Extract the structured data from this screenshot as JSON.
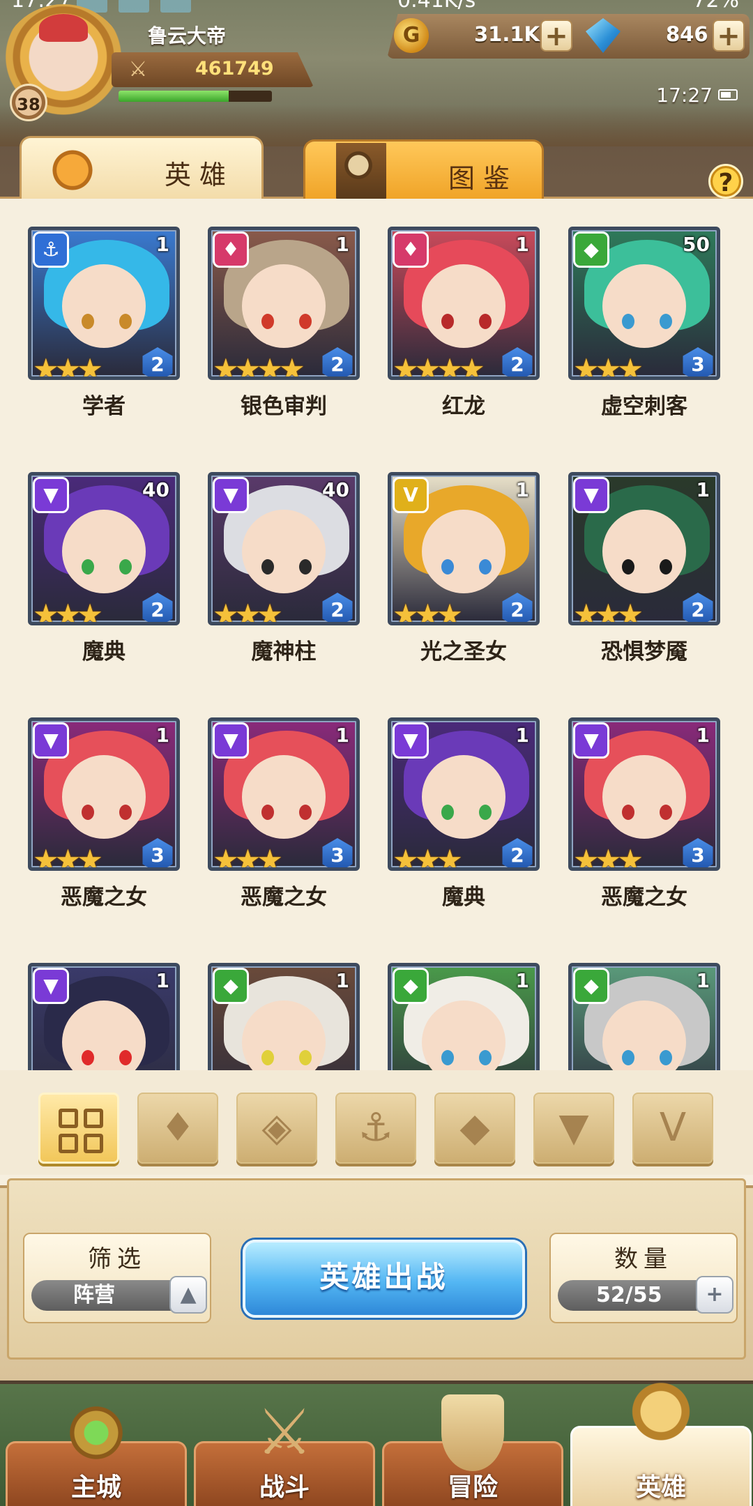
{
  "status_bar": {
    "time": "17:27",
    "network_speed": "0.41K/s",
    "signal": "4G",
    "battery": "72%"
  },
  "player": {
    "name": "鲁云大帝",
    "level": "38",
    "power": "461749",
    "exp_fraction": 0.72
  },
  "resources": {
    "gold": "31.1K",
    "gems": "846",
    "plus": "+"
  },
  "game_clock": "17:27",
  "tabs": {
    "heroes": "英雄",
    "codex": "图鉴"
  },
  "help": "?",
  "heroes": [
    {
      "name": "学者",
      "level": "1",
      "grade": "2",
      "stars": 3,
      "faction": "anchor",
      "faction_icon": "⚓",
      "faction_color": "#2f6fd6",
      "hair": "#35b8e8",
      "bg": "#3a7ad0",
      "eye": "#c98a2a"
    },
    {
      "name": "银色审判",
      "level": "1",
      "grade": "2",
      "stars": 4,
      "faction": "flame",
      "faction_icon": "♦",
      "faction_color": "#d63a6a",
      "hair": "#b9a58a",
      "bg": "#8a5a4a",
      "eye": "#d03a2a"
    },
    {
      "name": "红龙",
      "level": "1",
      "grade": "2",
      "stars": 4,
      "faction": "flame",
      "faction_icon": "♦",
      "faction_color": "#d63a6a",
      "hair": "#e64a5a",
      "bg": "#c94a5a",
      "eye": "#b82a2a"
    },
    {
      "name": "虚空刺客",
      "level": "50",
      "grade": "3",
      "stars": 3,
      "faction": "beast",
      "faction_icon": "◆",
      "faction_color": "#3aa83a",
      "hair": "#3cbf9a",
      "bg": "#2e7a5a",
      "eye": "#3a9ad0"
    },
    {
      "name": "魔典",
      "level": "40",
      "grade": "2",
      "stars": 3,
      "faction": "demon",
      "faction_icon": "▼",
      "faction_color": "#7a3ad6",
      "hair": "#6a3ab8",
      "bg": "#4a2a7a",
      "eye": "#3aa84a"
    },
    {
      "name": "魔神柱",
      "level": "40",
      "grade": "2",
      "stars": 3,
      "faction": "demon",
      "faction_icon": "▼",
      "faction_color": "#7a3ad6",
      "hair": "#dcdde2",
      "bg": "#5a3a6a",
      "eye": "#2a2a2a"
    },
    {
      "name": "光之圣女",
      "level": "1",
      "grade": "2",
      "stars": 3,
      "faction": "light",
      "faction_icon": "V",
      "faction_color": "#e0b01a",
      "hair": "#e8a82a",
      "bg": "#e8e0c8",
      "eye": "#3a8ad6"
    },
    {
      "name": "恐惧梦魇",
      "level": "1",
      "grade": "2",
      "stars": 3,
      "faction": "demon",
      "faction_icon": "▼",
      "faction_color": "#7a3ad6",
      "hair": "#2a6a4a",
      "bg": "#2a3a2a",
      "eye": "#1a1a1a"
    },
    {
      "name": "恶魔之女",
      "level": "1",
      "grade": "3",
      "stars": 3,
      "faction": "demon",
      "faction_icon": "▼",
      "faction_color": "#7a3ad6",
      "hair": "#e6505a",
      "bg": "#8a2a7a",
      "eye": "#c03030"
    },
    {
      "name": "恶魔之女",
      "level": "1",
      "grade": "3",
      "stars": 3,
      "faction": "demon",
      "faction_icon": "▼",
      "faction_color": "#7a3ad6",
      "hair": "#e6505a",
      "bg": "#8a2a7a",
      "eye": "#c03030"
    },
    {
      "name": "魔典",
      "level": "1",
      "grade": "2",
      "stars": 3,
      "faction": "demon",
      "faction_icon": "▼",
      "faction_color": "#7a3ad6",
      "hair": "#6a3ab8",
      "bg": "#4a2a7a",
      "eye": "#3aa84a"
    },
    {
      "name": "恶魔之女",
      "level": "1",
      "grade": "3",
      "stars": 3,
      "faction": "demon",
      "faction_icon": "▼",
      "faction_color": "#7a3ad6",
      "hair": "#e6505a",
      "bg": "#8a2a7a",
      "eye": "#c03030"
    },
    {
      "name": "",
      "level": "1",
      "grade": "",
      "stars": 0,
      "faction": "demon",
      "faction_icon": "▼",
      "faction_color": "#7a3ad6",
      "hair": "#2a2a4a",
      "bg": "#3a3a6a",
      "eye": "#e02a2a"
    },
    {
      "name": "",
      "level": "1",
      "grade": "",
      "stars": 0,
      "faction": "beast",
      "faction_icon": "◆",
      "faction_color": "#3aa83a",
      "hair": "#e8e4dc",
      "bg": "#6a4a3a",
      "eye": "#e0d03a"
    },
    {
      "name": "",
      "level": "1",
      "grade": "",
      "stars": 0,
      "faction": "beast",
      "faction_icon": "◆",
      "faction_color": "#3aa83a",
      "hair": "#f0ede6",
      "bg": "#4a9a4a",
      "eye": "#3a9ad0"
    },
    {
      "name": "",
      "level": "1",
      "grade": "",
      "stars": 0,
      "faction": "beast",
      "faction_icon": "◆",
      "faction_color": "#3aa83a",
      "hair": "#c8c8c8",
      "bg": "#5a9a7a",
      "eye": "#3a9ad0"
    }
  ],
  "faction_filters": [
    {
      "id": "all",
      "icon": "grid-icon",
      "glyph": "",
      "active": true
    },
    {
      "id": "flame",
      "icon": "flame-faction-icon",
      "glyph": "♦",
      "active": false
    },
    {
      "id": "rune",
      "icon": "rune-faction-icon",
      "glyph": "◈",
      "active": false
    },
    {
      "id": "anchor",
      "icon": "anchor-faction-icon",
      "glyph": "⚓",
      "active": false
    },
    {
      "id": "beast",
      "icon": "beast-faction-icon",
      "glyph": "◆",
      "active": false
    },
    {
      "id": "demon",
      "icon": "demon-faction-icon",
      "glyph": "▼",
      "active": false
    },
    {
      "id": "light",
      "icon": "light-faction-icon",
      "glyph": "V",
      "active": false
    }
  ],
  "filter_box": {
    "title": "筛选",
    "value": "阵营",
    "arrow": "▲"
  },
  "deploy_button": "英雄出战",
  "count_box": {
    "title": "数量",
    "value": "52/55",
    "plus": "+"
  },
  "bottom_nav": [
    {
      "label": "主城",
      "icon": "city",
      "active": false
    },
    {
      "label": "战斗",
      "icon": "battle",
      "active": false
    },
    {
      "label": "冒险",
      "icon": "adventure",
      "active": false
    },
    {
      "label": "英雄",
      "icon": "hero",
      "active": true
    }
  ]
}
